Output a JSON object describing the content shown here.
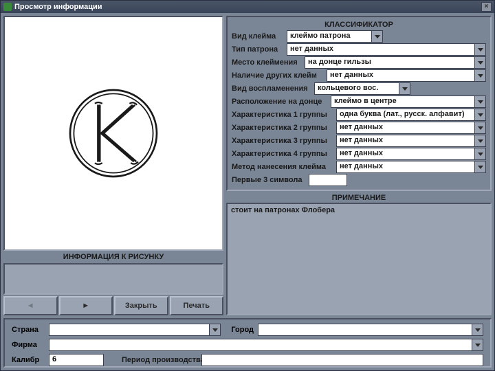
{
  "window": {
    "title": "Просмотр информации",
    "close_glyph": "×"
  },
  "left": {
    "info_header": "ИНФОРМАЦИЯ К РИСУНКУ",
    "nav_prev": "◄",
    "nav_next": "►",
    "btn_close": "Закрыть",
    "btn_print": "Печать"
  },
  "classifier": {
    "header": "КЛАССИФИКАТОР",
    "rows": {
      "stamp_kind": {
        "label": "Вид клейма",
        "value": "клеймо патрона"
      },
      "cartridge_type": {
        "label": "Тип патрона",
        "value": "нет данных"
      },
      "stamp_place": {
        "label": "Место клеймения",
        "value": "на донце гильзы"
      },
      "other_stamps": {
        "label": "Наличие других клейм",
        "value": "нет данных"
      },
      "ignition": {
        "label": "Вид воспламенения",
        "value": "кольцевого вос."
      },
      "location": {
        "label": "Расположение на донце",
        "value": "клеймо в центре"
      },
      "char1": {
        "label": "Характеристика 1 группы",
        "value": "одна буква (лат., русск. алфавит)"
      },
      "char2": {
        "label": "Характеристика 2 группы",
        "value": "нет данных"
      },
      "char3": {
        "label": "Характеристика 3 группы",
        "value": "нет данных"
      },
      "char4": {
        "label": "Характеристика 4 группы",
        "value": "нет данных"
      },
      "method": {
        "label": "Метод нанесения клейма",
        "value": "нет данных"
      },
      "first3": {
        "label": "Первые 3 символа",
        "value": ""
      }
    }
  },
  "note": {
    "header": "ПРИМЕЧАНИЕ",
    "text": "стоит на патронах Флобера"
  },
  "bottom": {
    "country": {
      "label": "Страна",
      "value": ""
    },
    "city": {
      "label": "Город",
      "value": ""
    },
    "firm": {
      "label": "Фирма",
      "value": ""
    },
    "caliber": {
      "label": "Калибр",
      "value": "6"
    },
    "period": {
      "label": "Период производства",
      "value": ""
    }
  }
}
